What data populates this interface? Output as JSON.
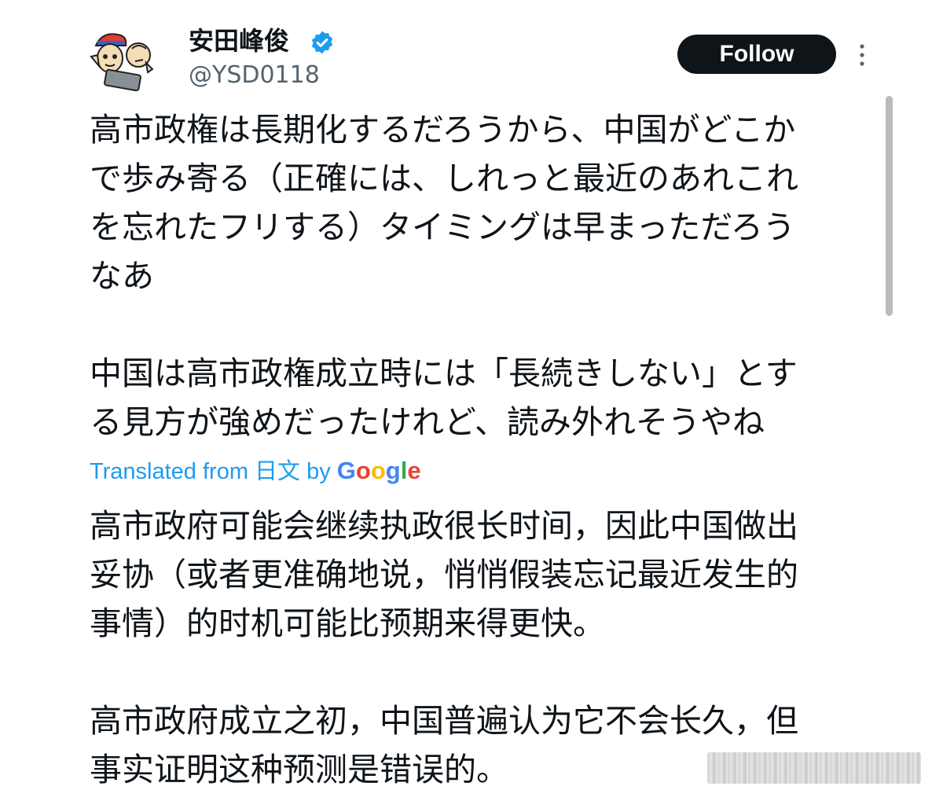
{
  "tweet": {
    "author": {
      "display_name": "安田峰俊",
      "handle": "@YSD0118",
      "verified": true,
      "avatar_icon": "cartoon-avatar-icon"
    },
    "follow_label": "Follow",
    "more_icon": "more-vertical-icon",
    "original_text": "高市政権は長期化するだろうから、中国がどこか\nで歩み寄る（正確には、しれっと最近のあれこれ\nを忘れたフリする）タイミングは早まっただろう\nなあ\n\n中国は高市政権成立時には「長続きしない」とす\nる見方が強めだったけれど、読み外れそうやね",
    "translation_note": {
      "prefix": "Translated from 日文 by ",
      "provider": "Google"
    },
    "translated_text": "高市政府可能会继续执政很长时间，因此中国做出\n妥协（或者更准确地说，悄悄假装忘记最近发生的\n事情）的时机可能比预期来得更快。\n\n高市政府成立之初，中国普遍认为它不会长久，但\n事实证明这种预测是错误的。"
  },
  "colors": {
    "text": "#0f1419",
    "secondary": "#536471",
    "link_blue": "#1d9bf0",
    "button_bg": "#0f1419",
    "button_text": "#ffffff"
  }
}
